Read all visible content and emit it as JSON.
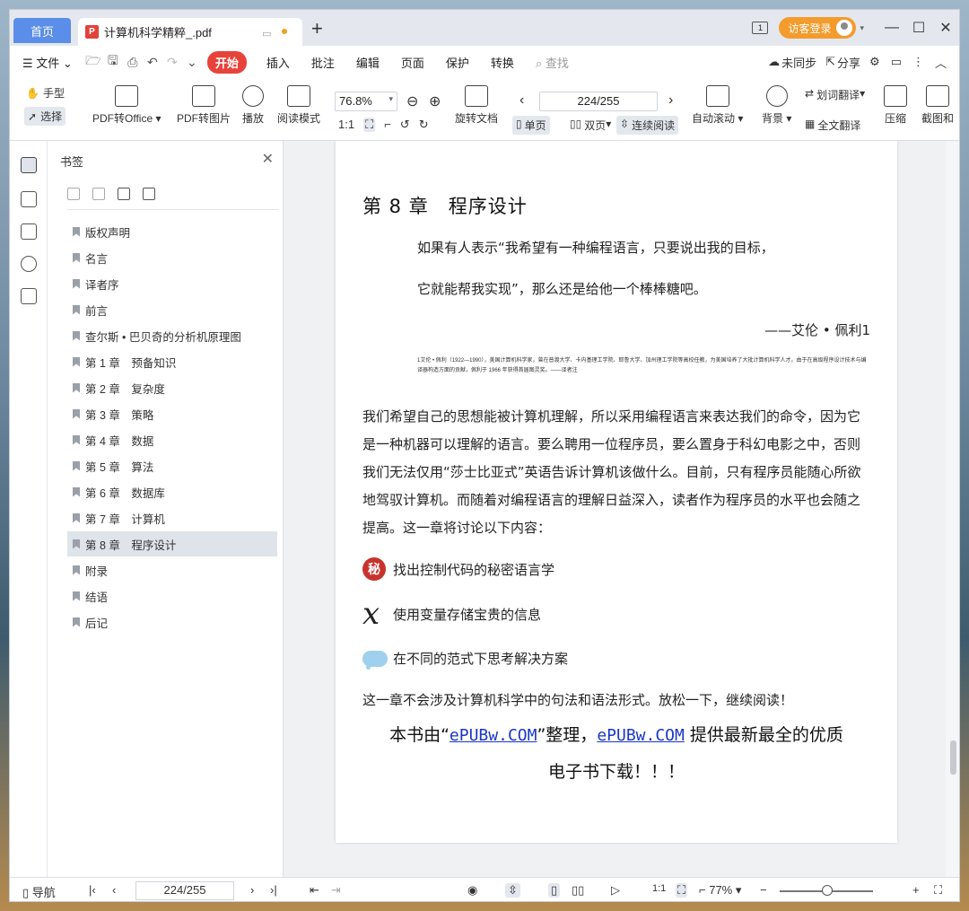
{
  "tabs": {
    "home": "首页",
    "doc_title": "计算机科学精粹_.pdf",
    "new_tab": "+"
  },
  "titlebar": {
    "login": "访客登录"
  },
  "menu": {
    "file": "文件",
    "start": "开始",
    "items": [
      "插入",
      "批注",
      "编辑",
      "页面",
      "保护",
      "转换"
    ],
    "search": "查找",
    "unsync": "未同步",
    "share": "分享"
  },
  "toolbar": {
    "hand": "手型",
    "select": "选择",
    "pdf_to_office": "PDF转Office",
    "pdf_to_image": "PDF转图片",
    "play": "播放",
    "read_mode": "阅读模式",
    "zoom": "76.8%",
    "rotate": "旋转文档",
    "page": "224/255",
    "single": "单页",
    "double": "双页",
    "continuous": "连续阅读",
    "autoscroll": "自动滚动",
    "background": "背景",
    "word_translate": "划词翻译",
    "full_translate": "全文翻译",
    "compress": "压缩",
    "screenshot": "截图和"
  },
  "sidebar": {
    "title": "书签",
    "items": [
      "版权声明",
      "名言",
      "译者序",
      "前言",
      "查尔斯 • 巴贝奇的分析机原理图",
      "第 1 章　预备知识",
      "第 2 章　复杂度",
      "第 3 章　策略",
      "第 4 章　数据",
      "第 5 章　算法",
      "第 6 章　数据库",
      "第 7 章　计算机",
      "第 8 章　程序设计",
      "附录",
      "结语",
      "后记"
    ],
    "selected_index": 12
  },
  "page": {
    "heading": "第 8 章　程序设计",
    "quote1": "如果有人表示“我希望有一种编程语言，只要说出我的目标，",
    "quote2": "它就能帮我实现”，那么还是给他一个棒棒糖吧。",
    "attribution": "——艾伦 • 佩利1",
    "footnote": "1艾伦 • 佩利（1922—1990），美国计算机科学家，曾在普渡大学、卡内基理工学院、耶鲁大学、加州理工学院等高校任教，为美国培养了大批计算机科学人才。由于在高级程序设计技术与编译器构造方面的贡献，佩利于 1966 年获得首届图灵奖。——译者注",
    "body": "我们希望自己的思想能被计算机理解，所以采用编程语言来表达我们的命令，因为它是一种机器可以理解的语言。要么聘用一位程序员，要么置身于科幻电影之中，否则我们无法仅用“莎士比亚式”英语告诉计算机该做什么。目前，只有程序员能随心所欲地驾驭计算机。而随着对编程语言的理解日益深入，读者作为程序员的水平也会随之提高。这一章将讨论以下内容：",
    "list": [
      {
        "icon": "秘",
        "text": "找出控制代码的秘密语言学"
      },
      {
        "icon": "x",
        "text": "使用变量存储宝贵的信息"
      },
      {
        "icon": "cloud",
        "text": "在不同的范式下思考解决方案"
      }
    ],
    "closing": "这一章不会涉及计算机科学中的句法和语法形式。放松一下，继续阅读！",
    "promo_pre": "本书由“",
    "promo_link1": "ePUBw.COM",
    "promo_mid": "”整理，",
    "promo_link2": "ePUBw.COM",
    "promo_post": " 提供最新最全的优质",
    "promo_line2": "电子书下载！！！"
  },
  "statusbar": {
    "nav": "导航",
    "page": "224/255",
    "zoom": "77%"
  },
  "colors": {
    "accent": "#5b8ee8",
    "start": "#e8433a",
    "login": "#f39b2d",
    "link": "#1a35c8"
  }
}
